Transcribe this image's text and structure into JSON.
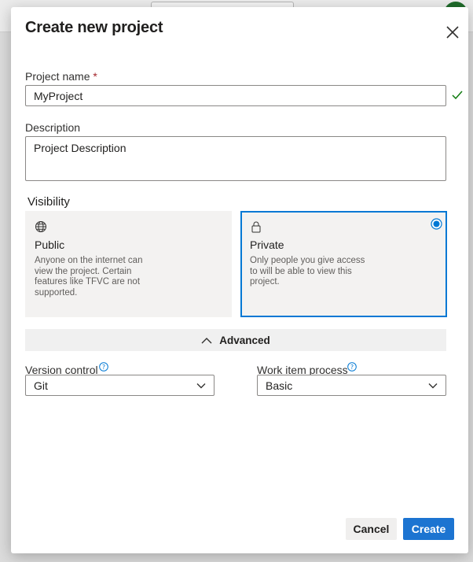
{
  "dialog": {
    "title": "Create new project"
  },
  "project_name": {
    "label": "Project name",
    "required_marker": "*",
    "value": "MyProject",
    "valid_icon": "checkmark-icon"
  },
  "description": {
    "label": "Description",
    "value": "Project Description"
  },
  "visibility": {
    "label": "Visibility",
    "selected": "Private",
    "options": [
      {
        "icon": "globe-icon",
        "title": "Public",
        "description": "Anyone on the internet can view the project. Certain features like TFVC are not supported."
      },
      {
        "icon": "lock-icon",
        "title": "Private",
        "description": "Only people you give access to will be able to view this project."
      }
    ]
  },
  "advanced": {
    "label": "Advanced",
    "icon": "chevron-up-icon"
  },
  "version_control": {
    "label": "Version control",
    "value": "Git"
  },
  "work_item_process": {
    "label": "Work item process",
    "value": "Basic"
  },
  "buttons": {
    "cancel": "Cancel",
    "create": "Create"
  },
  "colors": {
    "accent": "#0078d4",
    "primary_button": "#1c74d1",
    "required": "#a4262c",
    "valid": "#107c10"
  }
}
